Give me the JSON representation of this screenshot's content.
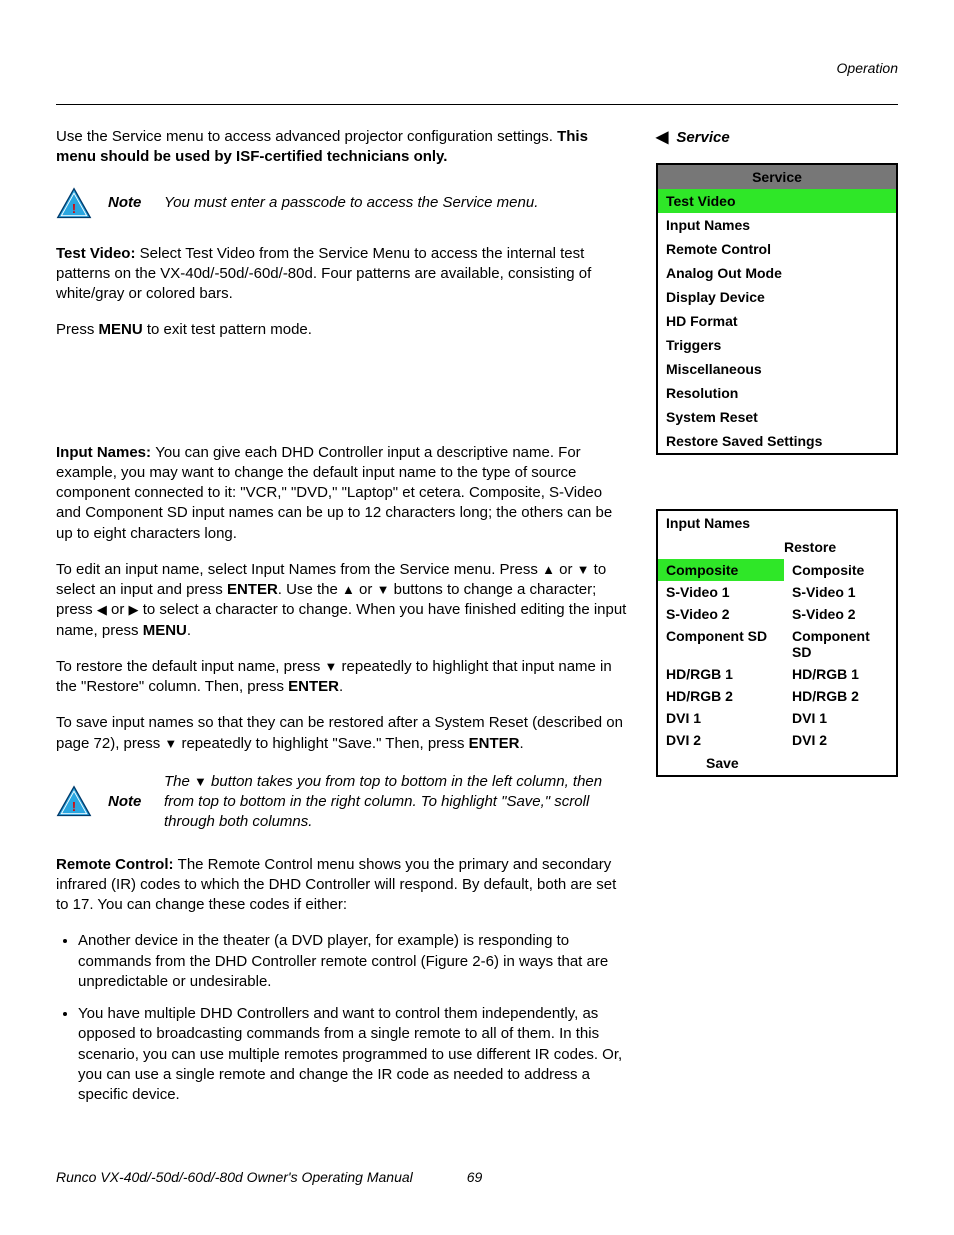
{
  "header": {
    "section": "Operation"
  },
  "sidebar_label": "Service",
  "intro": {
    "p1a": "Use the Service menu to access advanced projector configuration settings. ",
    "p1b": "This menu should be used by ISF-certified technicians only."
  },
  "note1": {
    "label": "Note",
    "text": "You must enter a passcode to access the Service menu."
  },
  "test_video": {
    "heading": "Test Video: ",
    "body": "Select Test Video from the Service Menu to access the internal test patterns on the VX-40d/-50d/-60d/-80d. Four patterns are available, consisting of white/gray or colored bars.",
    "p2a": "Press ",
    "p2b": "MENU",
    "p2c": " to exit test pattern mode."
  },
  "input_names": {
    "heading": "Input Names: ",
    "p1": "You can give each DHD Controller input a descriptive name. For example, you may want to change the default input name to the type of source component connected to it: \"VCR,\" \"DVD,\" \"Laptop\" et cetera. Composite, S-Video and Component SD input names can be up to 12 characters long; the others can be up to eight characters long.",
    "p2a": "To edit an input name, select Input Names from the Service menu. Press ",
    "p2b": " or ",
    "p2c": " to select an input and press ",
    "enter": "ENTER",
    "p2d": ". Use the ",
    "p2e": " or ",
    "p2f": " buttons to change a character; press ",
    "p2g": " or ",
    "p2h": " to select a character to change. When you have finished editing the input name, press ",
    "menu": "MENU",
    "p3a": "To restore the default input name, press ",
    "p3b": " repeatedly to highlight that input name in the \"Restore\" column. Then, press ",
    "p4a": "To save input names so that they can be restored after a System Reset (described on page 72), press ",
    "p4b": " repeatedly to highlight \"Save.\" Then, press "
  },
  "note2": {
    "label": "Note",
    "text_a": "The ",
    "text_b": " button takes you from top to bottom in the left column, then from top to bottom in the right column. To highlight \"Save,\" scroll through both columns."
  },
  "remote_control": {
    "heading": "Remote Control: ",
    "p1": "The Remote Control menu shows you the primary and secondary infrared (IR) codes to which the DHD Controller will respond. By default, both are set to 17. You can change these codes if either:",
    "bullets": [
      "Another device in the theater (a DVD player, for example) is responding to commands from the DHD Controller remote control (Figure 2-6) in ways that are unpredictable or undesirable.",
      "You have multiple DHD Controllers and want to control them independently, as opposed to broadcasting commands from a single remote to all of them. In this scenario, you can use multiple remotes programmed to use different IR codes. Or, you can use a single remote and change the IR code as needed to address a specific device."
    ]
  },
  "service_menu": {
    "title": "Service",
    "items": [
      "Test Video",
      "Input Names",
      "Remote Control",
      "Analog Out Mode",
      "Display Device",
      "HD Format",
      "Triggers",
      "Miscellaneous",
      "Resolution",
      "System Reset",
      "Restore Saved Settings"
    ]
  },
  "input_names_menu": {
    "title": "Input Names",
    "restore_label": "Restore",
    "rows": [
      {
        "l": "Composite",
        "r": "Composite"
      },
      {
        "l": "S-Video 1",
        "r": "S-Video 1"
      },
      {
        "l": "S-Video 2",
        "r": "S-Video 2"
      },
      {
        "l": "Component SD",
        "r": "Component SD"
      },
      {
        "l": "HD/RGB 1",
        "r": "HD/RGB 1"
      },
      {
        "l": "HD/RGB 2",
        "r": "HD/RGB 2"
      },
      {
        "l": "DVI 1",
        "r": "DVI 1"
      },
      {
        "l": "DVI 2",
        "r": "DVI 2"
      }
    ],
    "save": "Save"
  },
  "footer": {
    "title": "Runco VX-40d/-50d/-60d/-80d Owner's Operating Manual",
    "page": "69"
  }
}
